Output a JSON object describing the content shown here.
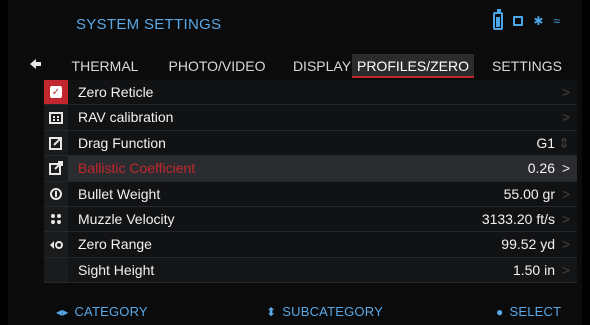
{
  "header": {
    "title": "SYSTEM SETTINGS",
    "icons": {
      "battery": "battery-icon",
      "sd": "sd-card-icon",
      "bluetooth": "bluetooth-icon",
      "wifi": "wifi-icon"
    }
  },
  "tabs": {
    "back_icon": "back-arrow-icon",
    "items": [
      {
        "label": "THERMAL"
      },
      {
        "label": "PHOTO/VIDEO"
      },
      {
        "label": "DISPLAY"
      },
      {
        "label": "PROFILES/ZERO"
      },
      {
        "label": "SETTINGS"
      }
    ],
    "active_index": 3
  },
  "menu": {
    "rows": [
      {
        "label": "Zero Reticle",
        "value": "",
        "chevron": ">"
      },
      {
        "label": "RAV calibration",
        "value": "",
        "chevron": ">"
      },
      {
        "label": "Drag Function",
        "value": "G1",
        "chevron": "⇕"
      },
      {
        "label": "Ballistic Coefficient",
        "value": "0.26",
        "chevron": ">"
      },
      {
        "label": "Bullet Weight",
        "value": "55.00 gr",
        "chevron": ">"
      },
      {
        "label": "Muzzle Velocity",
        "value": "3133.20 ft/s",
        "chevron": ">"
      },
      {
        "label": "Zero Range",
        "value": "99.52 yd",
        "chevron": ">"
      },
      {
        "label": "Sight Height",
        "value": "1.50 in",
        "chevron": ">"
      }
    ],
    "active_row": 3
  },
  "footer": {
    "category": "CATEGORY",
    "subcategory": "SUBCATEGORY",
    "select": "SELECT",
    "sym_left": "◂▸",
    "sym_mid": "⬍",
    "sym_right": "●"
  },
  "colors": {
    "accent_blue": "#5aa8e6",
    "accent_red": "#c1272d"
  }
}
